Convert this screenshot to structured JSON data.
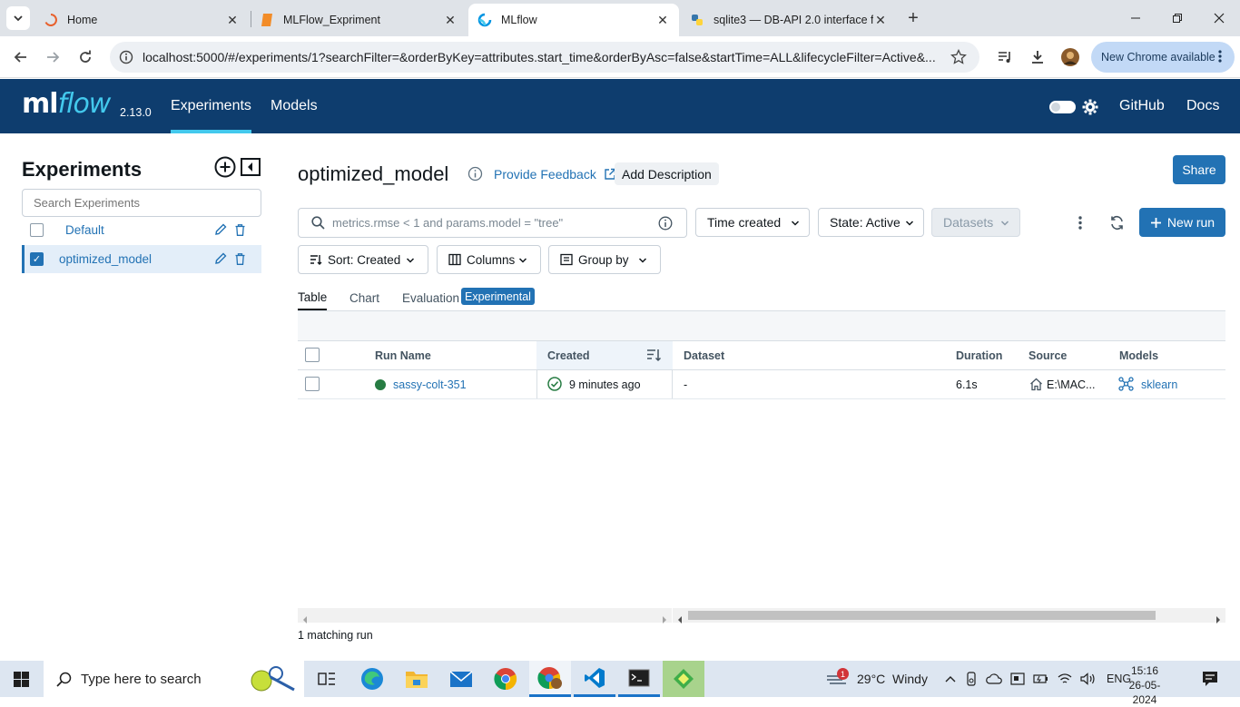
{
  "browser": {
    "tabs": [
      {
        "title": "Home"
      },
      {
        "title": "MLFlow_Expriment"
      },
      {
        "title": "MLflow"
      },
      {
        "title": "sqlite3 — DB-API 2.0 interface f"
      }
    ],
    "url": "localhost:5000/#/experiments/1?searchFilter=&orderByKey=attributes.start_time&orderByAsc=false&startTime=ALL&lifecycleFilter=Active&...",
    "new_chrome_label": "New Chrome available"
  },
  "header": {
    "logo_text": "mlflow",
    "version": "2.13.0",
    "nav": [
      "Experiments",
      "Models"
    ],
    "links": [
      "GitHub",
      "Docs"
    ]
  },
  "sidebar": {
    "title": "Experiments",
    "search_placeholder": "Search Experiments",
    "experiments": [
      {
        "name": "Default",
        "checked": false
      },
      {
        "name": "optimized_model",
        "checked": true
      }
    ]
  },
  "main": {
    "experiment_title": "optimized_model",
    "feedback_label": "Provide Feedback",
    "add_description_label": "Add Description",
    "share_label": "Share",
    "search_placeholder": "metrics.rmse < 1 and params.model = \"tree\"",
    "time_filter": "Time created",
    "state_filter": "State: Active",
    "datasets_filter": "Datasets",
    "new_run_label": "New run",
    "sort_label": "Sort: Created",
    "columns_label": "Columns",
    "group_by_label": "Group by",
    "view_tabs": [
      "Table",
      "Chart",
      "Evaluation"
    ],
    "experimental_badge": "Experimental",
    "table": {
      "headers": [
        "Run Name",
        "Created",
        "Dataset",
        "Duration",
        "Source",
        "Models"
      ],
      "rows": [
        {
          "run_name": "sassy-colt-351",
          "created": "9 minutes ago",
          "dataset": "-",
          "duration": "6.1s",
          "source": "E:\\MAC...",
          "model": "sklearn"
        }
      ]
    },
    "matching_runs": "1 matching run"
  },
  "taskbar": {
    "search_placeholder": "Type here to search",
    "weather": "29°C  Windy",
    "language": "ENG",
    "time": "15:16",
    "date": "26-05-2024",
    "notification_count": "1"
  }
}
